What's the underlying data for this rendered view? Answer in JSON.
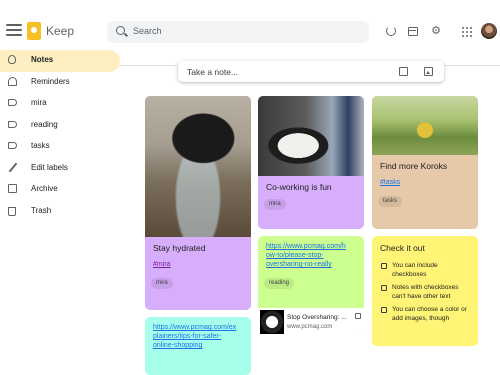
{
  "header": {
    "app_title": "Keep",
    "search_placeholder": "Search"
  },
  "sidebar": {
    "items": [
      {
        "label": "Notes",
        "icon": "bulb-icon",
        "active": true
      },
      {
        "label": "Reminders",
        "icon": "bell-icon"
      },
      {
        "label": "mira",
        "icon": "label-icon"
      },
      {
        "label": "reading",
        "icon": "label-icon"
      },
      {
        "label": "tasks",
        "icon": "label-icon"
      },
      {
        "label": "Edit labels",
        "icon": "pencil-icon"
      },
      {
        "label": "Archive",
        "icon": "archive-icon"
      },
      {
        "label": "Trash",
        "icon": "trash-icon"
      }
    ]
  },
  "take_note": {
    "label": "Take a note..."
  },
  "notes": {
    "hydrated": {
      "title": "Stay hydrated",
      "tag": "#mira",
      "label": "mira",
      "color": "#d7aefb"
    },
    "coworking": {
      "title": "Co-working is fun",
      "label": "mira",
      "color": "#d7aefb"
    },
    "koroks": {
      "title": "Find more Koroks",
      "tag": "#tasks",
      "label": "tasks",
      "color": "#e6c9a8"
    },
    "oversharing": {
      "link": "https://www.pcmag.com/how-to/please-stop-oversharing-no-really",
      "link_lines": [
        "https://www.pcmag.com/h",
        "ow-to/please-stop-",
        "oversharing-no-really"
      ],
      "label": "reading",
      "preview_title": "Stop Oversharing: ...",
      "preview_domain": "www.pcmag.com",
      "color": "#ccff90"
    },
    "checkit": {
      "title": "Check it out",
      "items": [
        "You can include checkboxes",
        "Notes with checkboxes can't have other text",
        "You can choose a color or add images, though"
      ],
      "item_lines": [
        [
          "You can include",
          "checkboxes"
        ],
        [
          "Notes with checkboxes",
          "can't have other text"
        ],
        [
          "You can choose a color or",
          "add images, though"
        ]
      ],
      "color": "#fff475"
    },
    "safer": {
      "link_lines": [
        "https://www.pcmag.com/ex",
        "plainers/tips-for-safer-",
        "online-shopping"
      ],
      "color": "#a7ffeb"
    }
  }
}
